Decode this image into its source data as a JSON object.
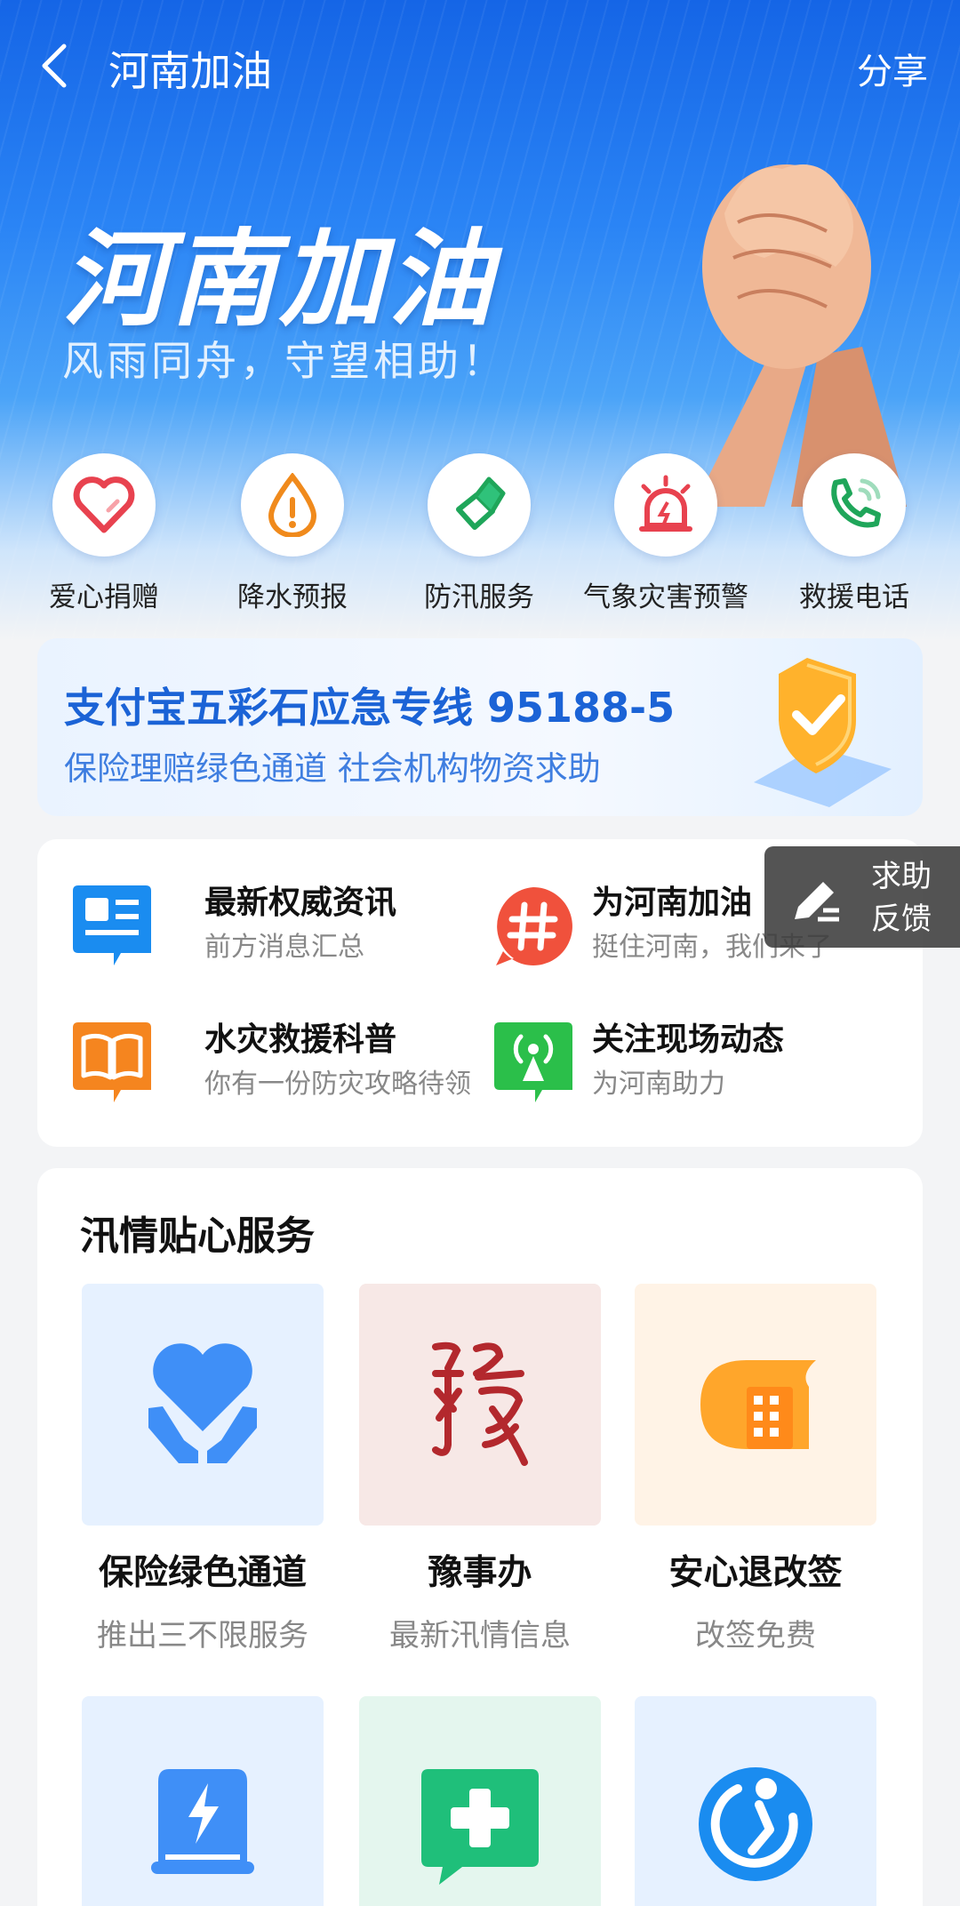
{
  "header": {
    "title": "河南加油",
    "share_label": "分享"
  },
  "hero": {
    "title": "河南加油",
    "subtitle": "风雨同舟，守望相助！"
  },
  "quick_actions": [
    {
      "label": "爱心捐赠",
      "icon": "heart-icon"
    },
    {
      "label": "降水预报",
      "icon": "raindrop-icon"
    },
    {
      "label": "防汛服务",
      "icon": "flag-icon"
    },
    {
      "label": "气象灾害预警",
      "icon": "alarm-icon"
    },
    {
      "label": "救援电话",
      "icon": "phone-icon"
    }
  ],
  "banner": {
    "title": "支付宝五彩石应急专线 95188-5",
    "subtitle": "保险理赔绿色通道 社会机构物资求助",
    "icon": "shield-check-icon"
  },
  "info_items": [
    {
      "title": "最新权威资讯",
      "subtitle": "前方消息汇总",
      "icon": "news-icon"
    },
    {
      "title": "为河南加油",
      "subtitle": "挺住河南，我们来了",
      "icon": "hashtag-icon"
    },
    {
      "title": "水灾救援科普",
      "subtitle": "你有一份防灾攻略待领",
      "icon": "book-icon"
    },
    {
      "title": "关注现场动态",
      "subtitle": "为河南助力",
      "icon": "broadcast-icon"
    }
  ],
  "feedback": {
    "line1": "求助",
    "line2": "反馈"
  },
  "service": {
    "title": "汛情贴心服务",
    "items": [
      {
        "title": "保险绿色通道",
        "subtitle": "推出三不限服务",
        "icon": "heart-hands-icon"
      },
      {
        "title": "豫事办",
        "subtitle": "最新汛情信息",
        "icon": "yu-seal-icon"
      },
      {
        "title": "安心退改签",
        "subtitle": "改签免费",
        "icon": "building-icon"
      },
      {
        "title": "",
        "subtitle": "",
        "icon": "power-bank-icon"
      },
      {
        "title": "",
        "subtitle": "",
        "icon": "medical-chat-icon"
      },
      {
        "title": "",
        "subtitle": "",
        "icon": "runner-icon"
      }
    ]
  },
  "colors": {
    "primary": "#1677ff",
    "hero_top": "#1565e6",
    "banner_text": "#1b63d6"
  }
}
